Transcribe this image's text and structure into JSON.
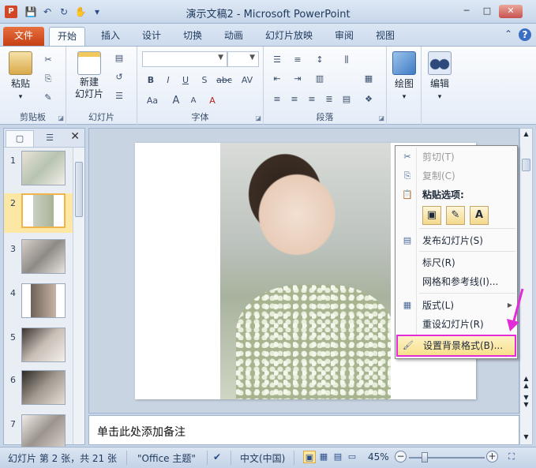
{
  "window": {
    "title": "演示文稿2 - Microsoft PowerPoint",
    "app_icon": "P",
    "minimize": "─",
    "maximize": "□",
    "close": "✕"
  },
  "qat": {
    "save": "💾",
    "undo": "↶",
    "redo": "↻",
    "touch": "✋",
    "customize": "▾"
  },
  "tabs": [
    {
      "label": "文件"
    },
    {
      "label": "开始"
    },
    {
      "label": "插入"
    },
    {
      "label": "设计"
    },
    {
      "label": "切换"
    },
    {
      "label": "动画"
    },
    {
      "label": "幻灯片放映"
    },
    {
      "label": "审阅"
    },
    {
      "label": "视图"
    }
  ],
  "ribbon": {
    "clipboard": {
      "label": "剪贴板",
      "paste": "粘贴"
    },
    "slides": {
      "label": "幻灯片",
      "new_slide": "新建\n幻灯片"
    },
    "font": {
      "label": "字体",
      "bold": "B",
      "italic": "I",
      "underline": "U",
      "shadow": "S",
      "strike": "abc",
      "spacing": "AV",
      "case": "Aa",
      "grow": "A",
      "shrink": "A",
      "clear": "A"
    },
    "paragraph": {
      "label": "段落"
    },
    "drawing": {
      "label": "",
      "draw": "绘图"
    },
    "editing": {
      "label": "",
      "edit": "编辑"
    }
  },
  "thumbnails": [
    {
      "num": "1"
    },
    {
      "num": "2"
    },
    {
      "num": "3"
    },
    {
      "num": "4"
    },
    {
      "num": "5"
    },
    {
      "num": "6"
    },
    {
      "num": "7"
    }
  ],
  "panel": {
    "close": "✕"
  },
  "context_menu": {
    "cut": "剪切(T)",
    "copy": "复制(C)",
    "paste_options": "粘贴选项:",
    "paste_opt3": "A",
    "publish": "发布幻灯片(S)",
    "ruler": "标尺(R)",
    "grid": "网格和参考线(I)...",
    "layout": "版式(L)",
    "reset": "重设幻灯片(R)",
    "format_bg": "设置背景格式(B)..."
  },
  "notes": {
    "placeholder": "单击此处添加备注"
  },
  "status": {
    "slide_info": "幻灯片 第 2 张，共 21 张",
    "theme": "\"Office 主题\"",
    "language": "中文(中国)",
    "zoom": "45%",
    "zoom_minus": "−",
    "zoom_plus": "+"
  },
  "colors": {
    "accent": "#d24726",
    "highlight_border": "#e32bd8",
    "ribbon_bg": "#fbfcfe"
  }
}
